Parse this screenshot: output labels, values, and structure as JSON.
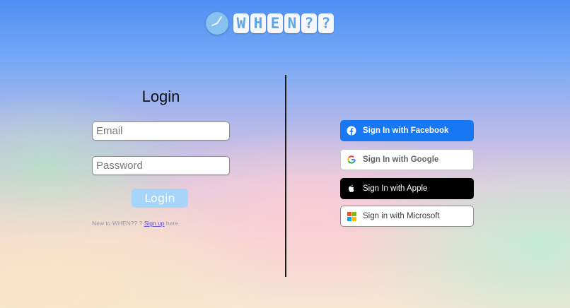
{
  "header": {
    "logo_letters": [
      "W",
      "H",
      "E",
      "N",
      "?",
      "?"
    ]
  },
  "login": {
    "title": "Login",
    "email_placeholder": "Email",
    "password_placeholder": "Password",
    "button_label": "Login",
    "signup_prefix": "New to WHEN?? ? ",
    "signup_link": "Sign up",
    "signup_suffix": " here."
  },
  "sso": {
    "facebook_label": "Sign In with Facebook",
    "google_label": "Sign In with Google",
    "apple_label": "Sign In with Apple",
    "microsoft_label": "Sign in with Microsoft"
  },
  "colors": {
    "facebook": "#1877f2",
    "apple": "#000000",
    "login_button": "#a7d4f9",
    "logo_tile_text": "#5fa6e6"
  },
  "icons": {
    "logo": "clock-icon",
    "facebook": "facebook-icon",
    "google": "google-icon",
    "apple": "apple-icon",
    "microsoft": "microsoft-icon"
  }
}
